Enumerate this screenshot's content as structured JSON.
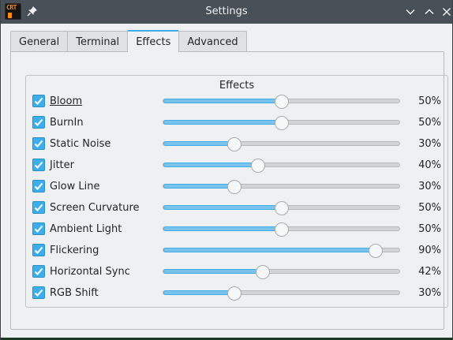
{
  "window": {
    "title": "Settings",
    "app_icon_text": "CRT"
  },
  "tabs": [
    {
      "label": "General",
      "active": false
    },
    {
      "label": "Terminal",
      "active": false
    },
    {
      "label": "Effects",
      "active": true
    },
    {
      "label": "Advanced",
      "active": false
    }
  ],
  "effects": {
    "title": "Effects",
    "items": [
      {
        "label": "Bloom",
        "checked": true,
        "value": 0.5,
        "value_text": "50%",
        "focused": true
      },
      {
        "label": "BurnIn",
        "checked": true,
        "value": 0.5,
        "value_text": "50%"
      },
      {
        "label": "Static Noise",
        "checked": true,
        "value": 0.3,
        "value_text": "30%"
      },
      {
        "label": "Jitter",
        "checked": true,
        "value": 0.4,
        "value_text": "40%"
      },
      {
        "label": "Glow Line",
        "checked": true,
        "value": 0.3,
        "value_text": "30%"
      },
      {
        "label": "Screen Curvature",
        "checked": true,
        "value": 0.5,
        "value_text": "50%"
      },
      {
        "label": "Ambient Light",
        "checked": true,
        "value": 0.5,
        "value_text": "50%"
      },
      {
        "label": "Flickering",
        "checked": true,
        "value": 0.9,
        "value_text": "90%"
      },
      {
        "label": "Horizontal Sync",
        "checked": true,
        "value": 0.42,
        "value_text": "42%"
      },
      {
        "label": "RGB Shift",
        "checked": true,
        "value": 0.3,
        "value_text": "30%"
      }
    ]
  },
  "colors": {
    "accent": "#3daee9",
    "titlebar": "#475057",
    "window_bg": "#eff0f1"
  }
}
